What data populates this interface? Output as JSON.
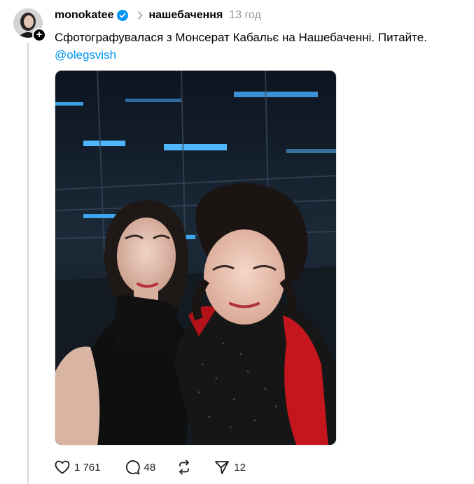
{
  "post": {
    "author": "monokatee",
    "topic": "нашебачення",
    "time": "13 год",
    "text": "Сфотографувалася з Монсерат Кабальє на Нашебаченні. Питайте.",
    "mention": "@olegsvish"
  },
  "actions": {
    "likes": "1 761",
    "comments": "48",
    "sends": "12"
  },
  "icons": {
    "verified": "verified-badge-icon",
    "follow": "plus-icon",
    "separator": "chevron-right-icon",
    "like": "heart-icon",
    "comment": "comment-bubble-icon",
    "repost": "repost-icon",
    "send": "send-icon"
  },
  "colors": {
    "verified": "#0095f6",
    "link": "#0095f6",
    "muted": "#999999"
  }
}
